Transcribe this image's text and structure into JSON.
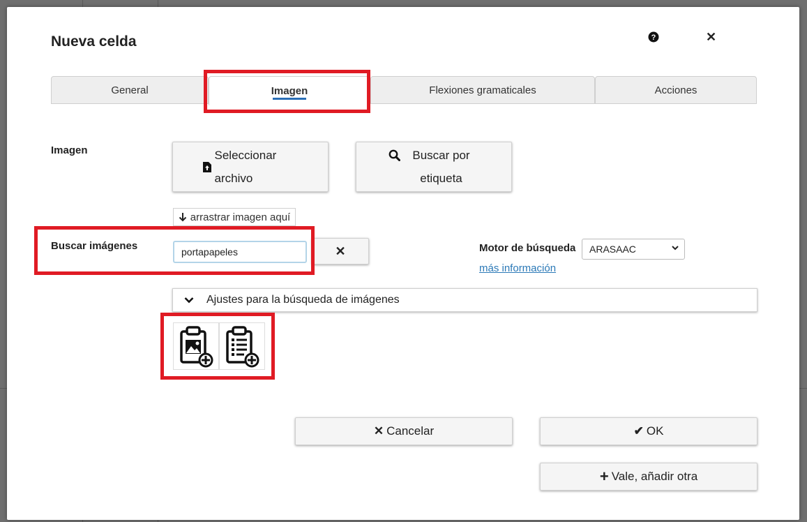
{
  "dialog": {
    "title": "Nueva celda",
    "help_icon": "question-circle-icon",
    "close_icon": "close-icon",
    "close_symbol": "✕"
  },
  "tabs": [
    {
      "label": "General",
      "active": false
    },
    {
      "label": "Imagen",
      "active": true
    },
    {
      "label": "Flexiones gramaticales",
      "active": false
    },
    {
      "label": "Acciones",
      "active": false
    }
  ],
  "image_section": {
    "label": "Imagen",
    "select_file_label": "Seleccionar archivo",
    "select_file_icon": "file-upload-icon",
    "search_tag_label": "Buscar por etiqueta",
    "search_tag_icon": "search-icon",
    "drag_hint": "arrastrar imagen aquí",
    "drag_icon": "arrow-down-icon"
  },
  "search": {
    "label": "Buscar imágenes",
    "value": "portapapeles",
    "clear_icon": "close-icon",
    "clear_symbol": "✕",
    "engine_label": "Motor de búsqueda",
    "engine_value": "ARASAAC",
    "more_info": "más información",
    "settings_label": "Ajustes para la búsqueda de imágenes",
    "settings_icon": "chevron-down-icon"
  },
  "results": [
    {
      "icon": "clipboard-image-add-icon"
    },
    {
      "icon": "clipboard-list-add-icon"
    }
  ],
  "footer": {
    "cancel_label": "Cancelar",
    "cancel_symbol": "✕",
    "ok_label": "OK",
    "ok_symbol": "✔",
    "add_another_label": "Vale, añadir otra",
    "add_another_symbol": "+"
  },
  "colors": {
    "highlight": "#e01b24",
    "accent": "#2b6fb6",
    "link": "#2b79b7"
  }
}
